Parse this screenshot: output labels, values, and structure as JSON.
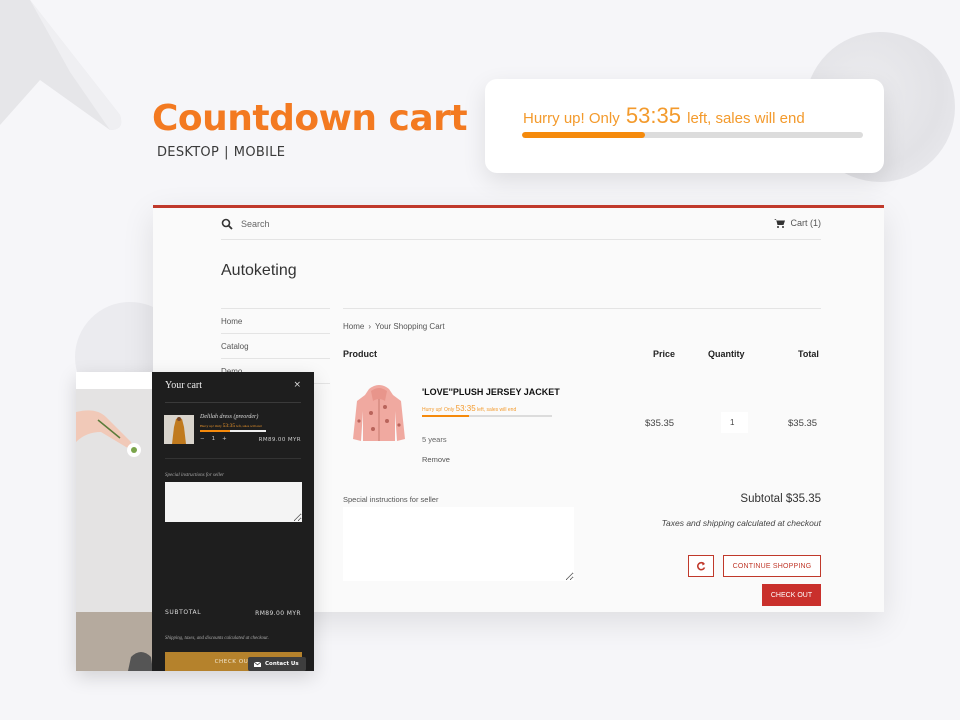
{
  "brand": {
    "accent": "#f37a21",
    "store_red": "#c0392b",
    "countdown_orange": "#f58a0c"
  },
  "hero": {
    "title": "Countdown cart",
    "platforms": [
      "DESKTOP",
      "MOBILE"
    ],
    "separator": "|"
  },
  "countdown": {
    "prefix": "Hurry up! Only",
    "timer": "53:35",
    "suffix": "left, sales will end",
    "progress_percent": 36
  },
  "store": {
    "search_label": "Search",
    "cart_label": "Cart (1)",
    "logo": "Autoketing",
    "nav": [
      "Home",
      "Catalog",
      "Demo"
    ],
    "breadcrumb": [
      "Home",
      "Your Shopping Cart"
    ],
    "breadcrumb_separator": "›",
    "columns": {
      "product": "Product",
      "price": "Price",
      "quantity": "Quantity",
      "total": "Total"
    },
    "item": {
      "title": "'LOVE''PLUSH JERSEY JACKET",
      "variant": "5 years",
      "remove_label": "Remove",
      "price": "$35.35",
      "quantity": "1",
      "total": "$35.35",
      "countdown_progress_percent": 36
    },
    "note_label": "Special instructions for seller",
    "subtotal": "Subtotal $35.35",
    "tax_note": "Taxes and shipping calculated at checkout",
    "continue_label": "CONTINUE SHOPPING",
    "checkout_label": "CHECK OUT"
  },
  "mobile": {
    "drawer_title": "Your cart",
    "close_symbol": "×",
    "item": {
      "title": "Delilah dress (preorder)",
      "quantity": "1",
      "minus": "−",
      "plus": "+",
      "price": "RM89.00 MYR",
      "countdown_progress_percent": 45
    },
    "note_label": "Special instructions for seller",
    "subtotal_label": "SUBTOTAL",
    "subtotal_value": "RM89.00 MYR",
    "ship_note": "Shipping, taxes, and discounts calculated at checkout.",
    "checkout_label": "CHECK OUT",
    "contact_label": "Contact Us"
  }
}
